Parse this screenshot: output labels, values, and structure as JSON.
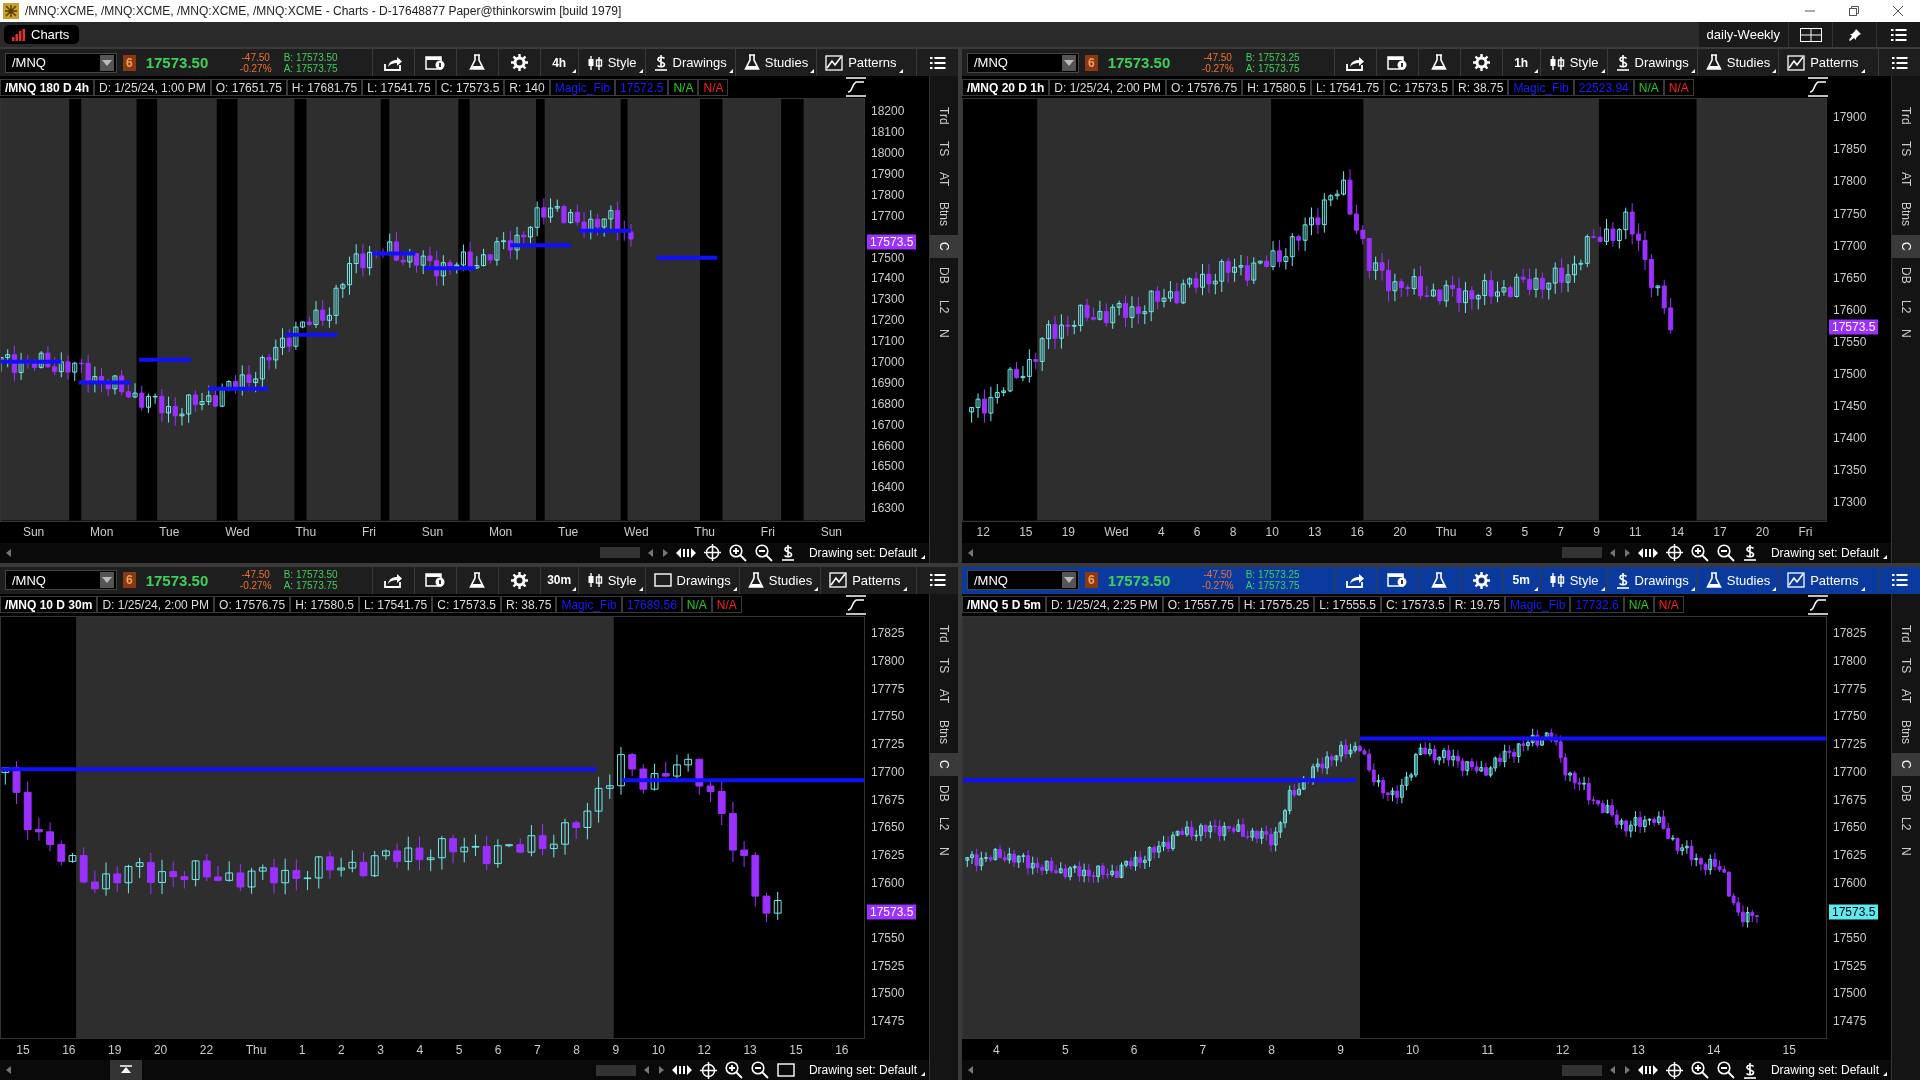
{
  "window": {
    "title": "/MNQ:XCME, /MNQ:XCME, /MNQ:XCME, /MNQ:XCME - Charts - D-17648877 Paper@thinkorswim [build 1979]"
  },
  "top_bar": {
    "tab": {
      "label": "Charts",
      "selected": true
    },
    "layout_name": "daily-Weekly"
  },
  "panes": [
    {
      "active": false,
      "symbol": "/MNQ",
      "link": "6",
      "last": "17573.50",
      "change": "-47.50",
      "change_pct": "-0.27%",
      "bid": "B: 17573.50",
      "ask": "A: 17573.75",
      "aggregation": "4h",
      "tools": [
        {
          "label": "Style",
          "kind": "style"
        },
        {
          "label": "Drawings",
          "kind": "dollar"
        },
        {
          "label": "Studies",
          "kind": "flask"
        },
        {
          "label": "Patterns",
          "kind": "patterns"
        }
      ],
      "info": [
        {
          "text": "/MNQ 180 D 4h",
          "kind": "title"
        },
        {
          "text": "D: 1/25/24, 1:00 PM",
          "kind": "field"
        },
        {
          "text": "O: 17651.75",
          "kind": "field"
        },
        {
          "text": "H: 17681.75",
          "kind": "field"
        },
        {
          "text": "L: 17541.75",
          "kind": "field"
        },
        {
          "text": "C: 17573.5",
          "kind": "field"
        },
        {
          "text": "R: 140",
          "kind": "field"
        },
        {
          "text": "Magic_Fib",
          "kind": "study"
        },
        {
          "text": "17572.5",
          "kind": "study_value"
        },
        {
          "text": "N/A",
          "kind": "up"
        },
        {
          "text": "N/A",
          "kind": "down"
        }
      ],
      "price_ticks": [
        "18200",
        "18100",
        "18000",
        "17900",
        "17800",
        "17700",
        "17500",
        "17400",
        "17300",
        "17200",
        "17100",
        "17000",
        "16900",
        "16800",
        "16700",
        "16600",
        "16500",
        "16400",
        "16300"
      ],
      "price_tag": {
        "text": "17573.5",
        "kind": "down"
      },
      "time_ticks": [
        "Sun",
        "Mon",
        "Tue",
        "Wed",
        "Thu",
        "Fri",
        "Sun",
        "Mon",
        "Tue",
        "Wed",
        "Thu",
        "Fri",
        "Sun"
      ],
      "side_tabs": [
        {
          "label": "Trd",
          "selected": false
        },
        {
          "label": "TS",
          "selected": false
        },
        {
          "label": "AT",
          "selected": false
        },
        {
          "label": "Btns",
          "selected": false
        },
        {
          "label": "C",
          "selected": true
        },
        {
          "label": "DB",
          "selected": false
        },
        {
          "label": "L2",
          "selected": false
        },
        {
          "label": "N",
          "selected": false
        }
      ],
      "bottom_tool": {
        "kind": "dollar"
      },
      "drawing_set": "Drawing set: Default"
    },
    {
      "active": false,
      "symbol": "/MNQ",
      "link": "6",
      "last": "17573.50",
      "change": "-47.50",
      "change_pct": "-0.27%",
      "bid": "B: 17573.25",
      "ask": "A: 17573.75",
      "aggregation": "1h",
      "tools": [
        {
          "label": "Style",
          "kind": "style"
        },
        {
          "label": "Drawings",
          "kind": "dollar"
        },
        {
          "label": "Studies",
          "kind": "flask"
        },
        {
          "label": "Patterns",
          "kind": "patterns"
        }
      ],
      "info": [
        {
          "text": "/MNQ 20 D 1h",
          "kind": "title"
        },
        {
          "text": "D: 1/25/24, 2:00 PM",
          "kind": "field"
        },
        {
          "text": "O: 17576.75",
          "kind": "field"
        },
        {
          "text": "H: 17580.5",
          "kind": "field"
        },
        {
          "text": "L: 17541.75",
          "kind": "field"
        },
        {
          "text": "C: 17573.5",
          "kind": "field"
        },
        {
          "text": "R: 38.75",
          "kind": "field"
        },
        {
          "text": "Magic_Fib",
          "kind": "study"
        },
        {
          "text": "22523.94",
          "kind": "study_value"
        },
        {
          "text": "N/A",
          "kind": "up"
        },
        {
          "text": "N/A",
          "kind": "down"
        }
      ],
      "price_ticks": [
        "17900",
        "17850",
        "17800",
        "17750",
        "17700",
        "17650",
        "17600",
        "17550",
        "17500",
        "17450",
        "17400",
        "17350",
        "17300"
      ],
      "price_tag": {
        "text": "17573.5",
        "kind": "down"
      },
      "time_ticks": [
        "12",
        "15",
        "19",
        "Wed",
        "4",
        "6",
        "8",
        "10",
        "13",
        "16",
        "20",
        "Thu",
        "3",
        "5",
        "7",
        "9",
        "11",
        "14",
        "17",
        "20",
        "Fri"
      ],
      "side_tabs": [
        {
          "label": "Trd",
          "selected": false
        },
        {
          "label": "TS",
          "selected": false
        },
        {
          "label": "AT",
          "selected": false
        },
        {
          "label": "Btns",
          "selected": false
        },
        {
          "label": "C",
          "selected": true
        },
        {
          "label": "DB",
          "selected": false
        },
        {
          "label": "L2",
          "selected": false
        },
        {
          "label": "N",
          "selected": false
        }
      ],
      "bottom_tool": {
        "kind": "dollar"
      },
      "drawing_set": "Drawing set: Default"
    },
    {
      "active": false,
      "symbol": "/MNQ",
      "link": "6",
      "last": "17573.50",
      "change": "-47.50",
      "change_pct": "-0.27%",
      "bid": "B: 17573.50",
      "ask": "A: 17573.75",
      "aggregation": "30m",
      "tools": [
        {
          "label": "Style",
          "kind": "style"
        },
        {
          "label": "Drawings",
          "kind": "rect"
        },
        {
          "label": "Studies",
          "kind": "flask"
        },
        {
          "label": "Patterns",
          "kind": "patterns"
        }
      ],
      "info": [
        {
          "text": "/MNQ 10 D 30m",
          "kind": "title"
        },
        {
          "text": "D: 1/25/24, 2:00 PM",
          "kind": "field"
        },
        {
          "text": "O: 17576.75",
          "kind": "field"
        },
        {
          "text": "H: 17580.5",
          "kind": "field"
        },
        {
          "text": "L: 17541.75",
          "kind": "field"
        },
        {
          "text": "C: 17573.5",
          "kind": "field"
        },
        {
          "text": "R: 38.75",
          "kind": "field"
        },
        {
          "text": "Magic_Fib",
          "kind": "study"
        },
        {
          "text": "17689.56",
          "kind": "study_value"
        },
        {
          "text": "N/A",
          "kind": "up"
        },
        {
          "text": "N/A",
          "kind": "down"
        }
      ],
      "price_ticks": [
        "17825",
        "17800",
        "17775",
        "17750",
        "17725",
        "17700",
        "17675",
        "17650",
        "17625",
        "17600",
        "17550",
        "17525",
        "17500",
        "17475"
      ],
      "price_tag": {
        "text": "17573.5",
        "kind": "down"
      },
      "time_ticks": [
        "15",
        "16",
        "19",
        "20",
        "22",
        "Thu",
        "1",
        "2",
        "3",
        "4",
        "5",
        "6",
        "7",
        "8",
        "9",
        "10",
        "12",
        "13",
        "15",
        "16"
      ],
      "side_tabs": [
        {
          "label": "Trd",
          "selected": false
        },
        {
          "label": "TS",
          "selected": false
        },
        {
          "label": "AT",
          "selected": false
        },
        {
          "label": "Btns",
          "selected": false
        },
        {
          "label": "C",
          "selected": true
        },
        {
          "label": "DB",
          "selected": false
        },
        {
          "label": "L2",
          "selected": false
        },
        {
          "label": "N",
          "selected": false
        }
      ],
      "expand_button": true,
      "bottom_tool": {
        "kind": "rect"
      },
      "drawing_set": "Drawing set: Default"
    },
    {
      "active": true,
      "symbol": "/MNQ",
      "link": "6",
      "last": "17573.50",
      "change": "-47.50",
      "change_pct": "-0.27%",
      "bid": "B: 17573.25",
      "ask": "A: 17573.75",
      "aggregation": "5m",
      "tools": [
        {
          "label": "Style",
          "kind": "style"
        },
        {
          "label": "Drawings",
          "kind": "dollar"
        },
        {
          "label": "Studies",
          "kind": "flask"
        },
        {
          "label": "Patterns",
          "kind": "patterns"
        }
      ],
      "info": [
        {
          "text": "/MNQ 5 D 5m",
          "kind": "title"
        },
        {
          "text": "D: 1/25/24, 2:25 PM",
          "kind": "field"
        },
        {
          "text": "O: 17557.75",
          "kind": "field"
        },
        {
          "text": "H: 17575.25",
          "kind": "field"
        },
        {
          "text": "L: 17555.5",
          "kind": "field"
        },
        {
          "text": "C: 17573.5",
          "kind": "field"
        },
        {
          "text": "R: 19.75",
          "kind": "field"
        },
        {
          "text": "Magic_Fib",
          "kind": "study"
        },
        {
          "text": "17732.6",
          "kind": "study_value"
        },
        {
          "text": "N/A",
          "kind": "up"
        },
        {
          "text": "N/A",
          "kind": "down"
        }
      ],
      "price_ticks": [
        "17825",
        "17800",
        "17775",
        "17750",
        "17725",
        "17700",
        "17675",
        "17650",
        "17625",
        "17600",
        "17550",
        "17525",
        "17500",
        "17475"
      ],
      "price_tag": {
        "text": "17573.5",
        "kind": "up"
      },
      "time_ticks": [
        "4",
        "5",
        "6",
        "7",
        "8",
        "9",
        "10",
        "11",
        "12",
        "13",
        "14",
        "15"
      ],
      "side_tabs": [
        {
          "label": "Trd",
          "selected": false
        },
        {
          "label": "TS",
          "selected": false
        },
        {
          "label": "AT",
          "selected": false
        },
        {
          "label": "Btns",
          "selected": false
        },
        {
          "label": "C",
          "selected": true
        },
        {
          "label": "DB",
          "selected": false
        },
        {
          "label": "L2",
          "selected": false
        },
        {
          "label": "N",
          "selected": false
        }
      ],
      "bottom_tool": {
        "kind": "dollar"
      },
      "drawing_set": "Drawing set: Default"
    }
  ]
}
